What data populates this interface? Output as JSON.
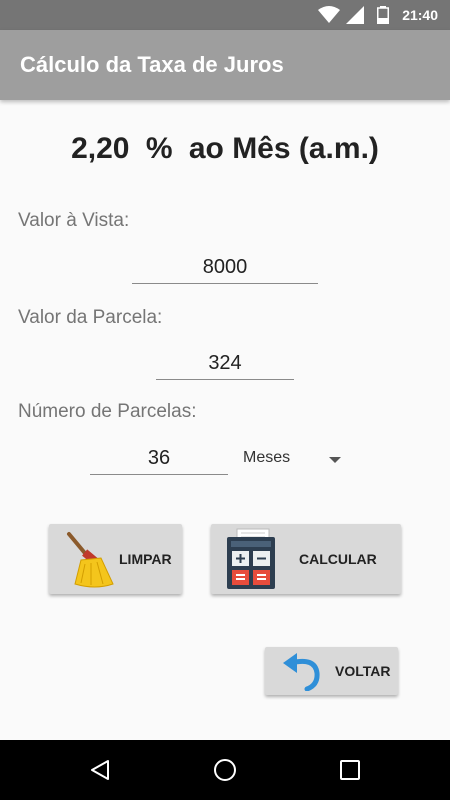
{
  "status_bar": {
    "time": "21:40",
    "icons": [
      "wifi-icon",
      "signal-icon",
      "battery-icon"
    ]
  },
  "app_bar": {
    "title": "Cálculo da Taxa de Juros"
  },
  "result": {
    "value": "2,20",
    "percent": "%",
    "period": "ao Mês (a.m.)"
  },
  "form": {
    "valor_vista_label": "Valor à Vista:",
    "valor_vista_value": "8000",
    "valor_parcela_label": "Valor da Parcela:",
    "valor_parcela_value": "324",
    "numero_parcelas_label": "Número de Parcelas:",
    "numero_parcelas_value": "36",
    "period_selected": "Meses"
  },
  "buttons": {
    "limpar": "LIMPAR",
    "calcular": "CALCULAR",
    "voltar": "VOLTAR"
  },
  "colors": {
    "app_bar": "#9e9e9e",
    "status_bar": "#757575",
    "button": "#d9d9d9",
    "background": "#fafafa"
  }
}
